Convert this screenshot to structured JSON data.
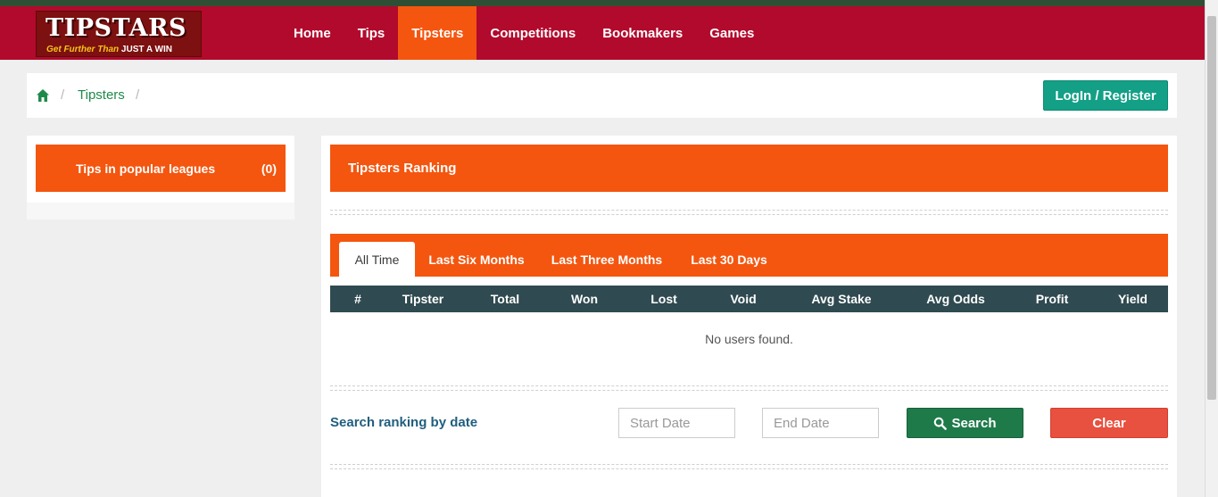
{
  "brand": {
    "logo_main": "TIPSTARS",
    "logo_tag_lead": "Get Further Than ",
    "logo_tag_bold": "JUST A WIN"
  },
  "nav": {
    "items": [
      "Home",
      "Tips",
      "Tipsters",
      "Competitions",
      "Bookmakers",
      "Games"
    ],
    "active": "Tipsters"
  },
  "breadcrumb": {
    "home_icon": "home-icon",
    "separator": "/",
    "current": "Tipsters"
  },
  "header": {
    "login_label": "LogIn / Register"
  },
  "sidebar": {
    "title": "Tips in popular leagues",
    "count": "(0)"
  },
  "ranking": {
    "title": "Tipsters Ranking",
    "tabs": [
      "All Time",
      "Last Six Months",
      "Last Three Months",
      "Last 30 Days"
    ],
    "active_tab": "All Time",
    "columns": [
      "#",
      "Tipster",
      "Total",
      "Won",
      "Lost",
      "Void",
      "Avg Stake",
      "Avg Odds",
      "Profit",
      "Yield"
    ],
    "rows": [],
    "empty_message": "No users found."
  },
  "search": {
    "label": "Search ranking by date",
    "start_placeholder": "Start Date",
    "end_placeholder": "End Date",
    "search_label": "Search",
    "search_icon": "magnifier-icon",
    "clear_label": "Clear"
  },
  "colors": {
    "navbar": "#b20a2c",
    "accent_orange": "#f4560f",
    "table_header": "#2f4a50",
    "login_button": "#13a087",
    "search_button": "#1f7a4a",
    "clear_button": "#e8503f",
    "link_green": "#1e8a4a",
    "label_blue": "#1f5e7e"
  }
}
